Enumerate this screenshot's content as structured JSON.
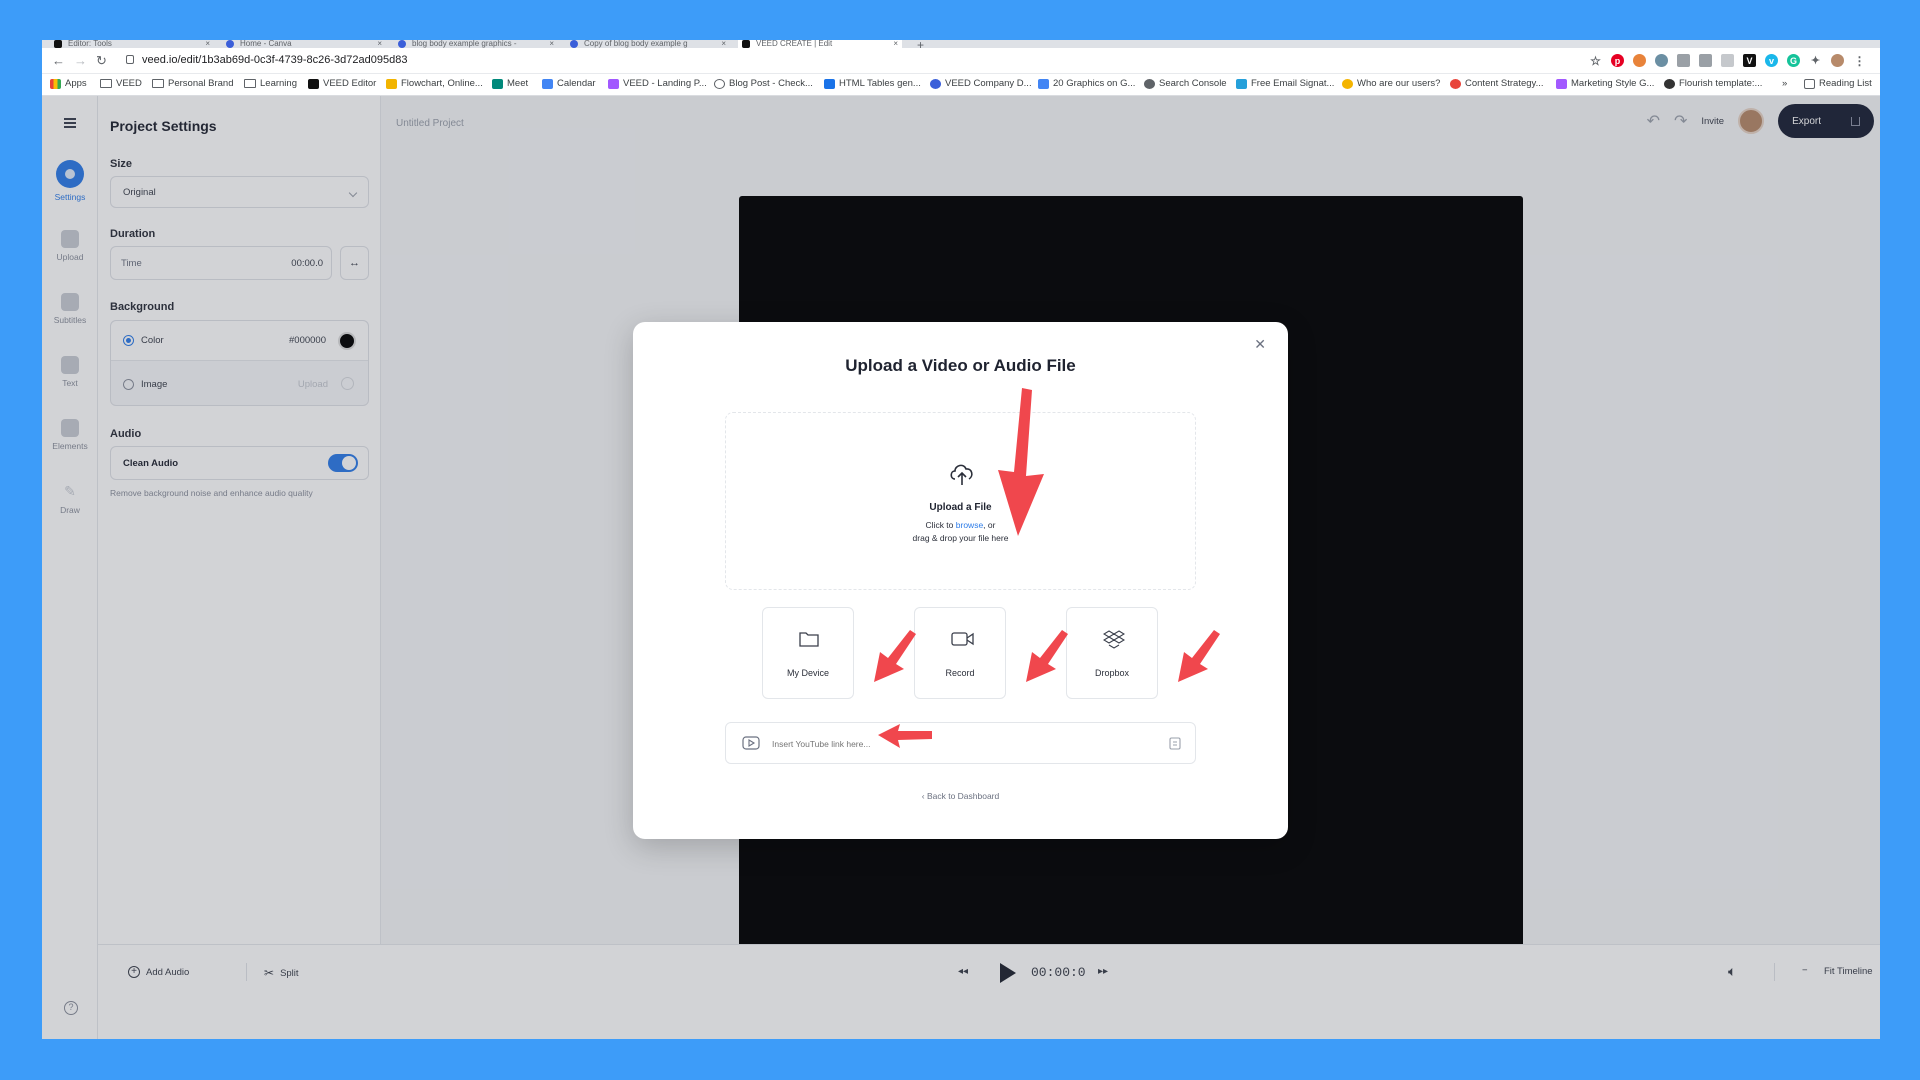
{
  "browser": {
    "tabs": [
      {
        "label": "Editor: Tools"
      },
      {
        "label": "Home - Canva"
      },
      {
        "label": "blog body example graphics -"
      },
      {
        "label": "Copy of blog body example g"
      },
      {
        "label": "VEED CREATE | Edit"
      }
    ],
    "url": "veed.io/edit/1b3ab69d-0c3f-4739-8c26-3d72ad095d83",
    "bookmarks": [
      "Apps",
      "VEED",
      "Personal Brand",
      "Learning",
      "VEED Editor",
      "Flowchart, Online...",
      "Meet",
      "Calendar",
      "VEED - Landing P...",
      "Blog Post - Check...",
      "HTML Tables gen...",
      "VEED Company D...",
      "20 Graphics on G...",
      "Search Console",
      "Free Email Signat...",
      "Who are our users?",
      "Content Strategy...",
      "Marketing Style G...",
      "Flourish template:..."
    ],
    "reading_list": "Reading List",
    "more_bookmarks": "»"
  },
  "rail": {
    "items": [
      {
        "label": "Settings"
      },
      {
        "label": "Upload"
      },
      {
        "label": "Subtitles"
      },
      {
        "label": "Text"
      },
      {
        "label": "Elements"
      },
      {
        "label": "Draw"
      }
    ]
  },
  "panel": {
    "title": "Project Settings",
    "size_label": "Size",
    "size_value": "Original",
    "duration_label": "Duration",
    "time_label": "Time",
    "time_value": "00:00.0",
    "background_label": "Background",
    "color_label": "Color",
    "color_value": "#000000",
    "image_label": "Image",
    "upload_label": "Upload",
    "audio_label": "Audio",
    "clean_audio_label": "Clean Audio",
    "clean_audio_hint": "Remove background noise and enhance audio quality"
  },
  "topbar": {
    "project_title": "Untitled Project",
    "invite_label": "Invite",
    "export_label": "Export"
  },
  "bottombar": {
    "add_audio_label": "Add Audio",
    "split_label": "Split",
    "timecode": "00:00:0",
    "fit_timeline_label": "Fit Timeline",
    "zoom_out": "−",
    "zoom_in": "+"
  },
  "modal": {
    "title": "Upload a Video or Audio File",
    "dropzone_title": "Upload a File",
    "dropzone_line1_prefix": "Click to ",
    "dropzone_browse": "browse",
    "dropzone_line1_suffix": ", or",
    "dropzone_line2": "drag & drop your file here",
    "options": [
      {
        "label": "My Device"
      },
      {
        "label": "Record"
      },
      {
        "label": "Dropbox"
      }
    ],
    "youtube_placeholder": "Insert YouTube link here...",
    "back_label": "Back to Dashboard"
  },
  "colors": {
    "accent": "#2d7ce8",
    "page_bg": "#3d9cf9",
    "annotation_arrow": "#f0474d",
    "export_bg": "#1c2236"
  }
}
